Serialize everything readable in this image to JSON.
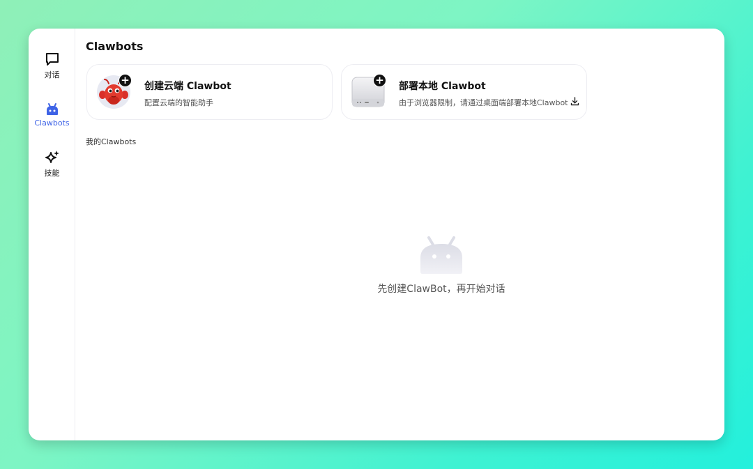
{
  "sidebar": {
    "items": [
      {
        "label": "对话",
        "icon": "chat-bubble-icon",
        "active": false
      },
      {
        "label": "Clawbots",
        "icon": "robot-icon",
        "active": true
      },
      {
        "label": "技能",
        "icon": "sparkle-icon",
        "active": false
      }
    ]
  },
  "header": {
    "title": "Clawbots"
  },
  "cards": [
    {
      "title": "创建云端 Clawbot",
      "subtitle": "配置云端的智能助手",
      "icon": "lobster-avatar-icon",
      "badge": "+"
    },
    {
      "title": "部署本地 Clawbot",
      "subtitle": "由于浏览器限制，请通过桌面端部署本地Clawbot",
      "icon": "mac-mini-icon",
      "badge": "+",
      "action_icon": "download-icon"
    }
  ],
  "section": {
    "label": "我的Clawbots"
  },
  "empty_state": {
    "icon": "robot-placeholder-icon",
    "text": "先创建ClawBot，再开始对话"
  },
  "colors": {
    "accent": "#3e63e6",
    "background_gradient_start": "#8ff0b8",
    "background_gradient_end": "#23f0dc"
  }
}
